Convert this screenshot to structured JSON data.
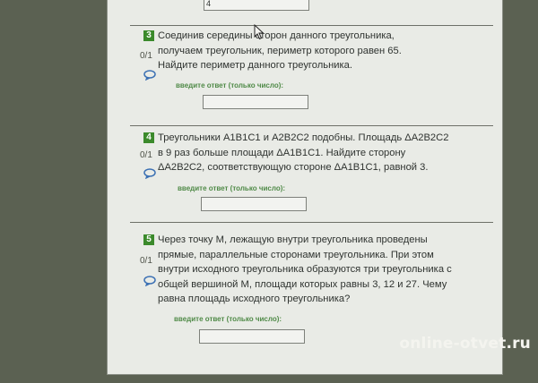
{
  "top_answer_value": "4",
  "questions": [
    {
      "number": "3",
      "score": "0/1",
      "text": "Соединив середины сторон данного треугольника, получаем треугольник, периметр которого равен 65. Найдите периметр данного треугольника.",
      "answer_hint": "введите ответ (только число):",
      "answer_value": ""
    },
    {
      "number": "4",
      "score": "0/1",
      "text": "Треугольники A1B1C1 и A2B2C2 подобны. Площадь ΔA2B2C2 в 9 раз больше площади ΔA1B1C1. Найдите сторону ΔA2B2C2, соответствующую стороне ΔA1B1C1, равной 3.",
      "answer_hint": "введите ответ (только число):",
      "answer_value": ""
    },
    {
      "number": "5",
      "score": "0/1",
      "text": "Через точку М, лежащую внутри треугольника проведены прямые, параллельные сторонами треугольника. При этом внутри исходного треугольника образуются три треугольника с общей вершиной М, площади которых равны 3, 12 и 27. Чему равна площадь исходного треугольника?",
      "answer_hint": "введите ответ (только число):",
      "answer_value": ""
    }
  ],
  "watermark": "online-otvet.ru",
  "icons": {
    "comment": "comment-bubble-icon",
    "cursor": "mouse-pointer-icon"
  },
  "colors": {
    "number_badge": "#3b8a2b",
    "hint_text": "#4f8a47"
  }
}
